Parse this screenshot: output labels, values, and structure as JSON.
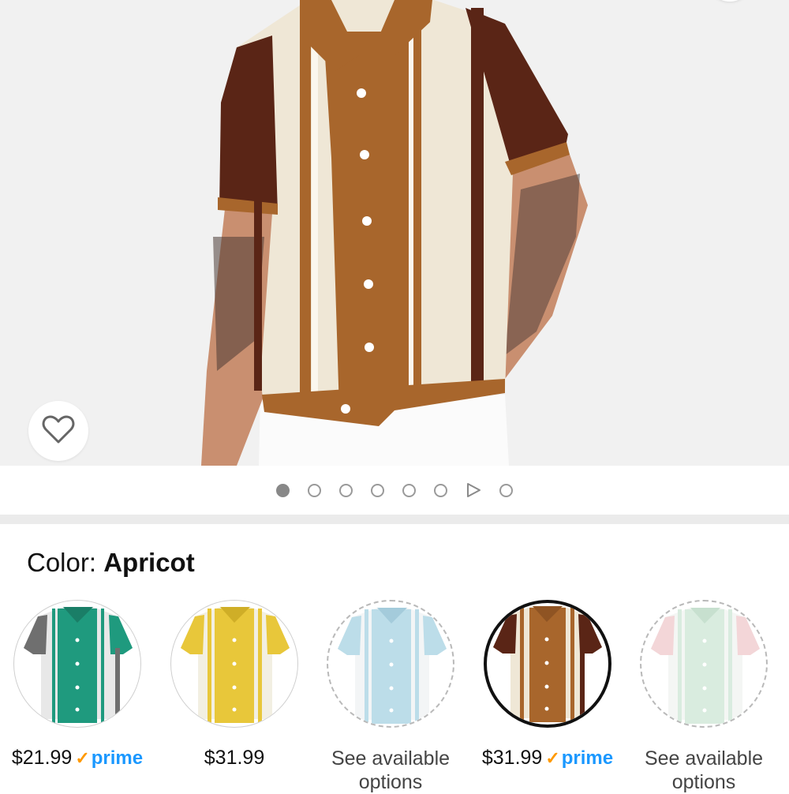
{
  "color_section": {
    "label": "Color:",
    "selected": "Apricot"
  },
  "swatches": [
    {
      "price": "$21.99",
      "prime": "prime",
      "colors": {
        "body": "#e8e8e8",
        "main": "#1f9a7e",
        "sleeve": "#6f6f6f"
      }
    },
    {
      "price": "$31.99",
      "prime": "",
      "colors": {
        "body": "#f2efe2",
        "main": "#e8c73a",
        "sleeve": "#e8c73a"
      }
    },
    {
      "availability": "See available options",
      "colors": {
        "body": "#f3f5f6",
        "main": "#bcdde9",
        "sleeve": "#bcdde9"
      }
    },
    {
      "price": "$31.99",
      "prime": "prime",
      "colors": {
        "body": "#efe7d6",
        "main": "#a8662c",
        "sleeve": "#5a2516"
      }
    },
    {
      "availability": "See available options",
      "colors": {
        "body": "#f4f6f4",
        "main": "#d9ecdf",
        "sleeve": "#f3d6d8"
      }
    }
  ],
  "icons": {
    "wishlist": "heart-icon",
    "video": "play-icon",
    "prime_check": "check-icon"
  },
  "pager": {
    "count": 8,
    "active_index": 0,
    "video_index": 6
  }
}
